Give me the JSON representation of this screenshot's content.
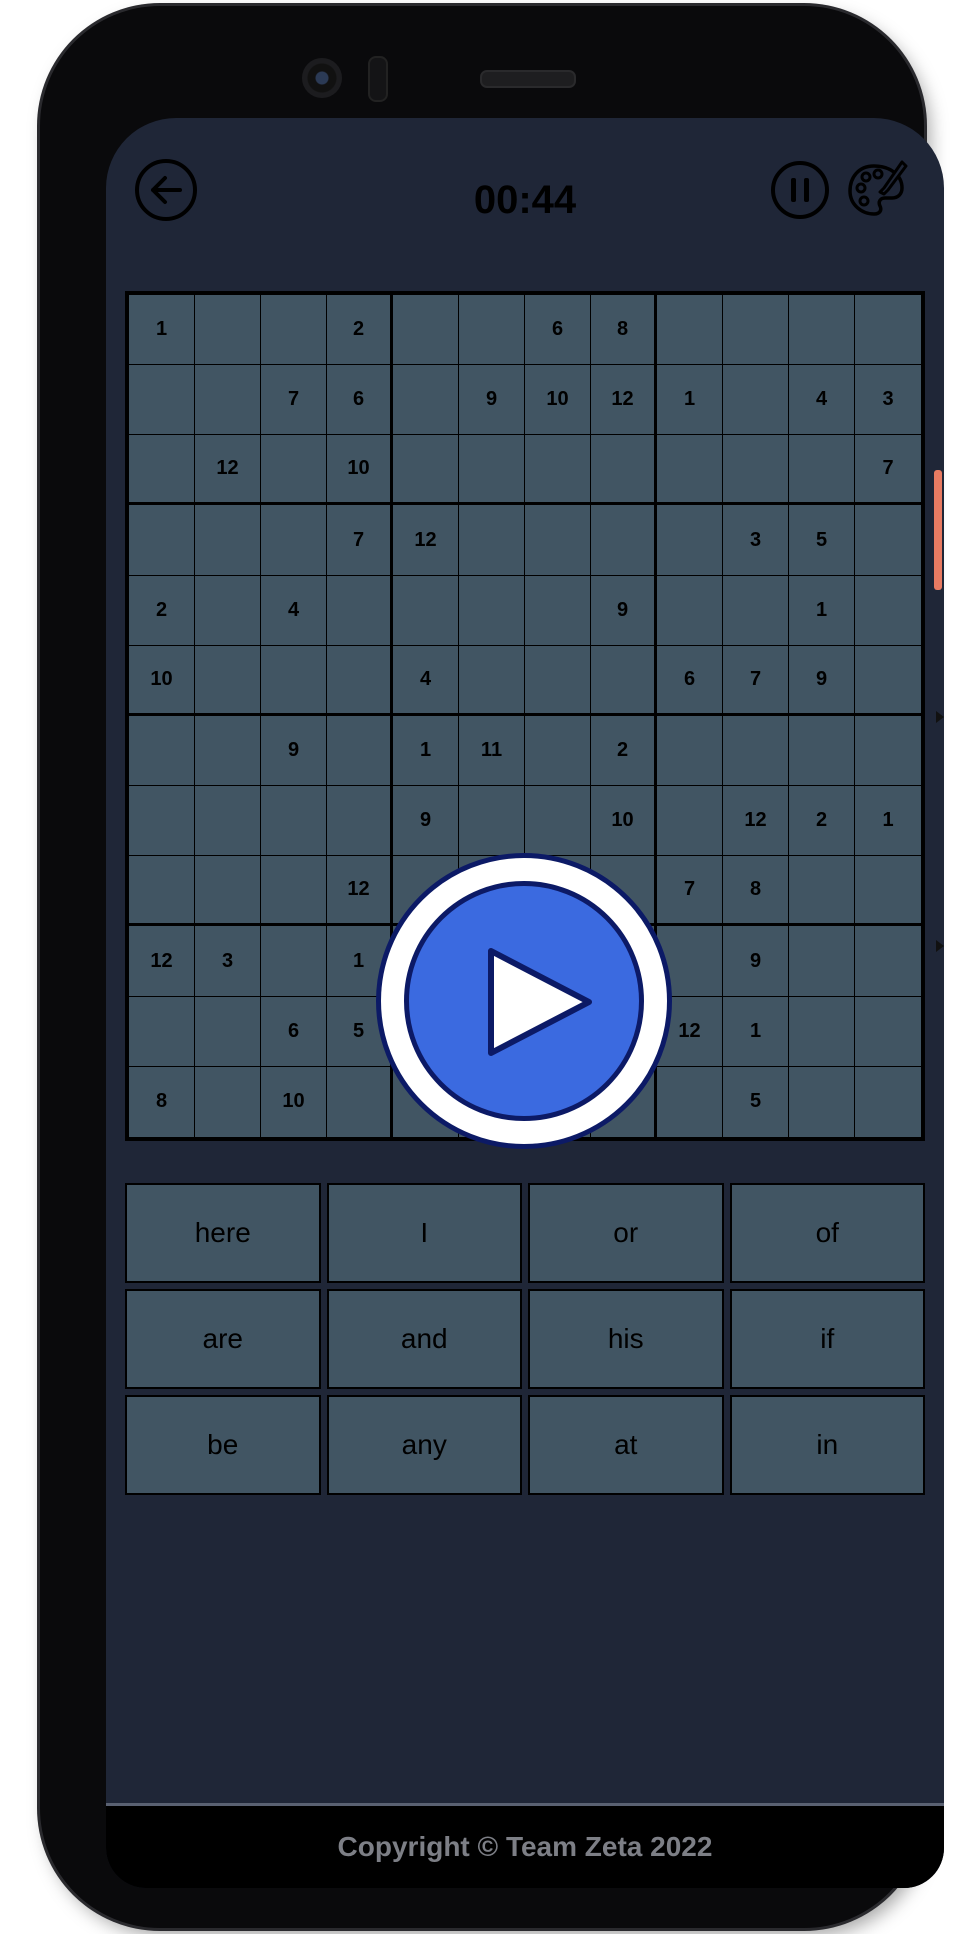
{
  "header": {
    "back_icon": "arrow-left-icon",
    "timer": "00:44",
    "pause_icon": "pause-icon",
    "theme_icon": "palette-icon"
  },
  "board": {
    "size": 12,
    "rows": [
      [
        "1",
        "",
        "",
        "2",
        "",
        "",
        "6",
        "8",
        "",
        "",
        "",
        ""
      ],
      [
        "",
        "",
        "7",
        "6",
        "",
        "9",
        "10",
        "12",
        "1",
        "",
        "4",
        "3"
      ],
      [
        "",
        "12",
        "",
        "10",
        "",
        "",
        "",
        "",
        "",
        "",
        "",
        "7"
      ],
      [
        "",
        "",
        "",
        "7",
        "12",
        "",
        "",
        "",
        "",
        "3",
        "5",
        ""
      ],
      [
        "2",
        "",
        "4",
        "",
        "",
        "",
        "",
        "9",
        "",
        "",
        "1",
        ""
      ],
      [
        "10",
        "",
        "",
        "",
        "4",
        "",
        "",
        "",
        "6",
        "7",
        "9",
        ""
      ],
      [
        "",
        "",
        "9",
        "",
        "1",
        "11",
        "",
        "2",
        "",
        "",
        "",
        ""
      ],
      [
        "",
        "",
        "",
        "",
        "9",
        "",
        "",
        "10",
        "",
        "12",
        "2",
        "1"
      ],
      [
        "",
        "",
        "",
        "12",
        "",
        "",
        "",
        "",
        "7",
        "8",
        "",
        ""
      ],
      [
        "12",
        "3",
        "",
        "1",
        "",
        "",
        "",
        "",
        "",
        "9",
        "",
        ""
      ],
      [
        "",
        "",
        "6",
        "5",
        "",
        "",
        "",
        "",
        "12",
        "1",
        "",
        ""
      ],
      [
        "8",
        "",
        "10",
        "",
        "",
        "",
        "",
        "",
        "",
        "5",
        "",
        ""
      ]
    ]
  },
  "keypad": {
    "keys": [
      "here",
      "I",
      "or",
      "of",
      "are",
      "and",
      "his",
      "if",
      "be",
      "any",
      "at",
      "in"
    ]
  },
  "overlay": {
    "play_icon": "play-icon"
  },
  "footer": {
    "copyright": "Copyright © Team Zeta 2022"
  },
  "colors": {
    "background": "#1f2637",
    "cell": "#415563",
    "play_fill": "#3b6ae0",
    "play_border": "#0c1a66"
  }
}
